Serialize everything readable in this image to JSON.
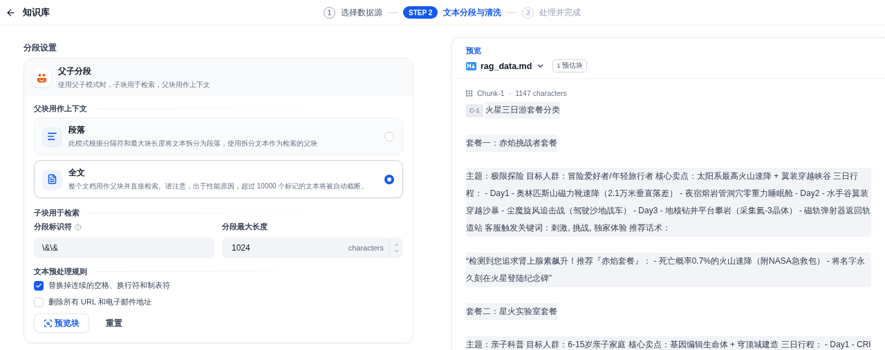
{
  "header": {
    "title": "知识库"
  },
  "steps": [
    {
      "number": "1",
      "label": "选择数据源",
      "selected": false,
      "done": true
    },
    {
      "number": "STEP 2",
      "label": "文本分段与清洗",
      "selected": true,
      "done": false
    },
    {
      "number": "3",
      "label": "处理并完成",
      "selected": false,
      "done": false
    }
  ],
  "settings": {
    "heading": "分段设置",
    "mode": {
      "title": "父子分段",
      "description": "使用父子模式时，子块用于检索，父块用作上下文"
    },
    "parent": {
      "heading": "父块用作上下文",
      "options": [
        {
          "kind": "paragraph",
          "title": "段落",
          "description": "此模式根据分隔符和最大块长度将文本拆分为段落，使用拆分文本作为检索的父块",
          "selected": false
        },
        {
          "kind": "document",
          "title": "全文",
          "description": "整个文档用作父块并直接检索。请注意，出于性能原因，超过 10000 个标记的文本将被自动截断。",
          "selected": true
        }
      ]
    },
    "child": {
      "heading": "子块用于检索",
      "separator": {
        "label": "分段标识符",
        "value": "\\&\\&"
      },
      "max_length": {
        "label": "分段最大长度",
        "value": "1024",
        "unit": "characters"
      }
    },
    "rules": {
      "heading": "文本预处理规则",
      "items": [
        {
          "label": "替换掉连续的空格、换行符和制表符",
          "checked": true
        },
        {
          "label": "删除所有 URL 和电子邮件地址",
          "checked": false
        }
      ]
    },
    "buttons": [
      {
        "kind": "primary",
        "label": "预览块"
      },
      {
        "kind": "plain",
        "label": "重置"
      }
    ]
  },
  "preview": {
    "label": "预览",
    "file": "rag_data.md",
    "estimate": "1 预估块",
    "chunk": {
      "name": "Chunk-1",
      "separator": "·",
      "size": "1147 characters",
      "tag": "C-1",
      "paragraphs": [
        "火星三日游套餐分类",
        "套餐一：赤焰挑战者套餐",
        "主题：极限探险 目标人群：冒险爱好者/年轻旅行者 核心卖点：太阳系最高火山速降 + 翼装穿越峡谷 三日行程： - Day1 - 奥林匹斯山磁力靴速降（2.1万米垂直落差） - 夜宿熔岩管洞穴零重力睡眠舱 - Day2 - 水手谷翼装穿越沙暴 - 尘魔旋风追击战（驾驶沙地战车） - Day3 - 地核钻井平台攀岩（采集氦-3晶体） - 磁轨弹射器返回轨道站 客服触发关键词：刺激, 挑战, 独家体验 推荐话术：",
        "“检测到您追求肾上腺素飙升！推荐『赤焰套餐』： - 死亡概率0.7%的火山速降（附NASA急救包） - 将名字永久刻在火星登陆纪念碑”",
        "套餐二：星火实验室套餐",
        "主题：亲子科普 目标人群：6-15岁亲子家庭 核心卖点：基因编辑生命体 + 穹顶城建造 三日行程： - Day1 - CRI"
      ]
    }
  }
}
